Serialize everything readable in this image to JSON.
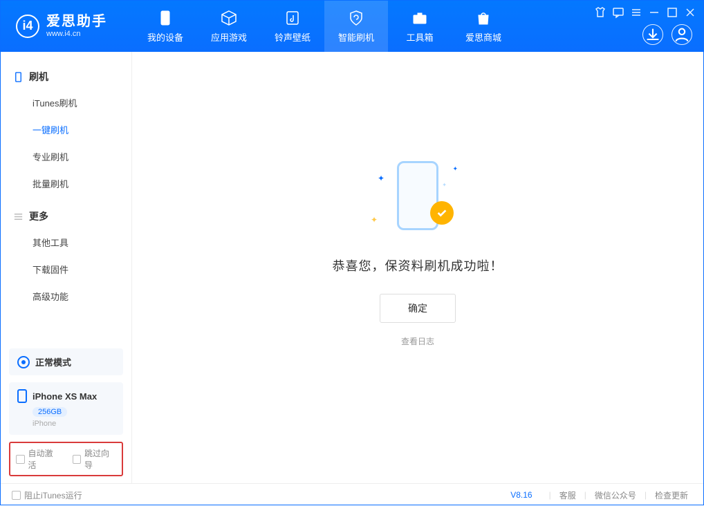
{
  "brand": {
    "name": "爱思助手",
    "domain": "www.i4.cn"
  },
  "nav": {
    "my_device": "我的设备",
    "apps_games": "应用游戏",
    "ringtones_wallpapers": "铃声壁纸",
    "smart_flash": "智能刷机",
    "toolbox": "工具箱",
    "store": "爱思商城"
  },
  "sidebar": {
    "section_flash": "刷机",
    "items_flash": [
      "iTunes刷机",
      "一键刷机",
      "专业刷机",
      "批量刷机"
    ],
    "section_more": "更多",
    "items_more": [
      "其他工具",
      "下载固件",
      "高级功能"
    ],
    "mode_label": "正常模式",
    "device_name": "iPhone XS Max",
    "device_storage": "256GB",
    "device_type": "iPhone",
    "cb_auto_activate": "自动激活",
    "cb_skip_guide": "跳过向导"
  },
  "main": {
    "success_message": "恭喜您，保资料刷机成功啦！",
    "ok_button": "确定",
    "view_log": "查看日志"
  },
  "footer": {
    "stop_itunes": "阻止iTunes运行",
    "version": "V8.16",
    "support": "客服",
    "wechat": "微信公众号",
    "check_update": "检查更新"
  }
}
